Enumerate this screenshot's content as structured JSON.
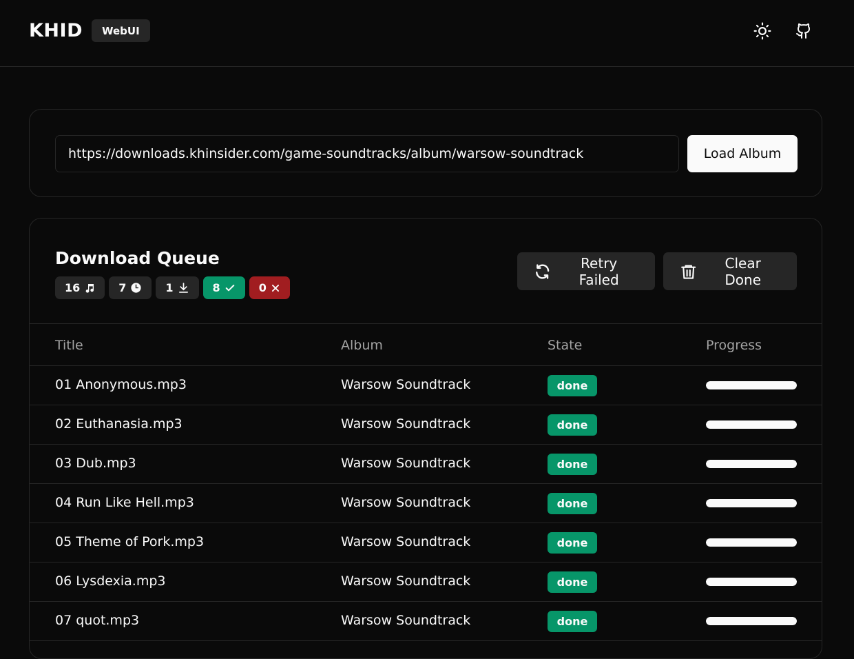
{
  "app": {
    "name": "KHID",
    "badge": "WebUI"
  },
  "header": {
    "theme_icon": "sun-icon",
    "github_icon": "github-icon"
  },
  "url_form": {
    "value": "https://downloads.khinsider.com/game-soundtracks/album/warsow-soundtrack",
    "load_label": "Load Album"
  },
  "queue": {
    "title": "Download Queue",
    "stats": {
      "total": "16",
      "pending": "7",
      "downloading": "1",
      "done": "8",
      "failed": "0"
    },
    "retry_label": "Retry Failed",
    "clear_label": "Clear Done",
    "columns": {
      "title": "Title",
      "album": "Album",
      "state": "State",
      "progress": "Progress"
    },
    "rows": [
      {
        "title": "01 Anonymous.mp3",
        "album": "Warsow Soundtrack",
        "state": "done",
        "progress": 1.0
      },
      {
        "title": "02 Euthanasia.mp3",
        "album": "Warsow Soundtrack",
        "state": "done",
        "progress": 1.0
      },
      {
        "title": "03 Dub.mp3",
        "album": "Warsow Soundtrack",
        "state": "done",
        "progress": 1.0
      },
      {
        "title": "04 Run Like Hell.mp3",
        "album": "Warsow Soundtrack",
        "state": "done",
        "progress": 1.0
      },
      {
        "title": "05 Theme of Pork.mp3",
        "album": "Warsow Soundtrack",
        "state": "done",
        "progress": 1.0
      },
      {
        "title": "06 Lysdexia.mp3",
        "album": "Warsow Soundtrack",
        "state": "done",
        "progress": 1.0
      },
      {
        "title": "07 quot.mp3",
        "album": "Warsow Soundtrack",
        "state": "done",
        "progress": 1.0
      }
    ]
  },
  "colors": {
    "background": "#0a0a0a",
    "surface": "#262626",
    "success": "#079669",
    "danger": "#a11d20",
    "foreground": "#fafafa"
  }
}
